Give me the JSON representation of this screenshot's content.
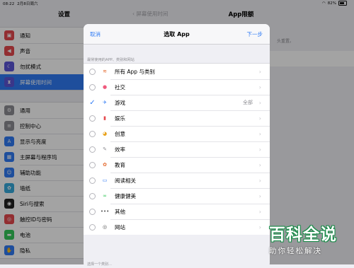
{
  "status": {
    "time": "08:22",
    "date": "2月8日周六",
    "battery": "82%"
  },
  "sidebar": {
    "title": "设置",
    "groups": [
      {
        "items": [
          {
            "label": "通知",
            "icon": "notifications-icon",
            "color": "#e5484d"
          },
          {
            "label": "声音",
            "icon": "sound-icon",
            "color": "#e5484d"
          },
          {
            "label": "勿扰模式",
            "icon": "moon-icon",
            "color": "#5b55d6"
          },
          {
            "label": "屏幕使用时间",
            "icon": "hourglass-icon",
            "color": "#5b55d6",
            "selected": true
          }
        ]
      },
      {
        "items": [
          {
            "label": "通用",
            "icon": "gear-icon",
            "color": "#8e8e93"
          },
          {
            "label": "控制中心",
            "icon": "control-center-icon",
            "color": "#8e8e93"
          },
          {
            "label": "显示与亮度",
            "icon": "brightness-icon",
            "color": "#2f7bf5"
          },
          {
            "label": "主屏幕与程序坞",
            "icon": "home-screen-icon",
            "color": "#2f7bf5"
          },
          {
            "label": "辅助功能",
            "icon": "accessibility-icon",
            "color": "#2f7bf5"
          },
          {
            "label": "墙纸",
            "icon": "wallpaper-icon",
            "color": "#36aadc"
          },
          {
            "label": "Siri与搜索",
            "icon": "siri-icon",
            "color": "#222"
          },
          {
            "label": "触控ID与密码",
            "icon": "fingerprint-icon",
            "color": "#e5484d"
          },
          {
            "label": "电池",
            "icon": "battery-icon",
            "color": "#34c759"
          },
          {
            "label": "隐私",
            "icon": "hand-icon",
            "color": "#2f7bf5"
          }
        ]
      }
    ]
  },
  "right_pane": {
    "back_label": "屏幕使用时间",
    "title": "App限额",
    "note": "头重置。"
  },
  "modal": {
    "cancel": "取消",
    "title": "选取 App",
    "next": "下一步",
    "section_header": "最常使用的APP、类别和网站",
    "rows": [
      {
        "label": "所有 App 与类别",
        "icon": "stack-icon",
        "glyph": "≋",
        "color": "#e46a2e",
        "selected": false,
        "value": ""
      },
      {
        "label": "社交",
        "icon": "social-icon",
        "glyph": "●",
        "color": "#ef5a7d",
        "selected": false,
        "value": ""
      },
      {
        "label": "游戏",
        "icon": "rocket-icon",
        "glyph": "✈",
        "color": "#2f7bf5",
        "selected": true,
        "value": "全部"
      },
      {
        "label": "娱乐",
        "icon": "popcorn-icon",
        "glyph": "▮",
        "color": "#e5484d",
        "selected": false,
        "value": ""
      },
      {
        "label": "创意",
        "icon": "palette-icon",
        "glyph": "◕",
        "color": "#e9a21b",
        "selected": false,
        "value": ""
      },
      {
        "label": "效率",
        "icon": "pen-icon",
        "glyph": "✎",
        "color": "#8e8e93",
        "selected": false,
        "value": ""
      },
      {
        "label": "教育",
        "icon": "globe-icon",
        "glyph": "✿",
        "color": "#e46a2e",
        "selected": false,
        "value": ""
      },
      {
        "label": "阅读相关",
        "icon": "book-icon",
        "glyph": "▭",
        "color": "#2f7bf5",
        "selected": false,
        "value": ""
      },
      {
        "label": "健康健美",
        "icon": "bicycle-icon",
        "glyph": "∞",
        "color": "#34c759",
        "selected": false,
        "value": ""
      },
      {
        "label": "其他",
        "icon": "more-icon",
        "glyph": "•••",
        "color": "#555",
        "selected": false,
        "value": ""
      },
      {
        "label": "网站",
        "icon": "compass-icon",
        "glyph": "◎",
        "color": "#555",
        "selected": false,
        "value": ""
      }
    ],
    "footer": "选择一个类别…"
  },
  "watermark": {
    "big": "百科全说",
    "small": "助你轻松解决"
  }
}
